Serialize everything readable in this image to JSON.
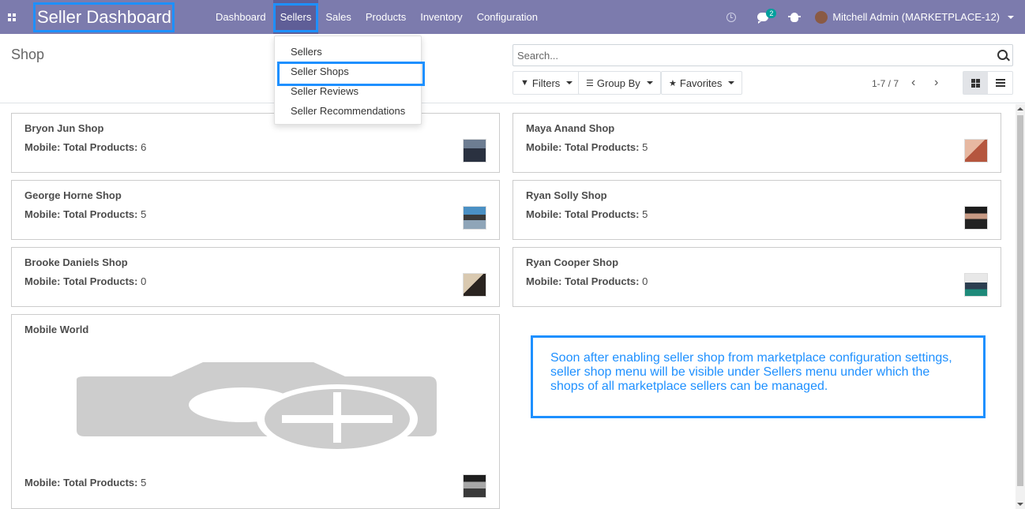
{
  "navbar": {
    "brand": "Seller Dashboard",
    "menu": [
      "Dashboard",
      "Sellers",
      "Sales",
      "Products",
      "Inventory",
      "Configuration"
    ],
    "active_menu": "Sellers",
    "chat_badge": "2",
    "user": "Mitchell Admin (MARKETPLACE-12)"
  },
  "sellers_dropdown": {
    "items": [
      "Sellers",
      "Seller Shops",
      "Seller Reviews",
      "Seller Recommendations"
    ],
    "highlighted": "Seller Shops"
  },
  "control_panel": {
    "breadcrumb": "Shop",
    "search_placeholder": "Search...",
    "filters_label": "Filters",
    "groupby_label": "Group By",
    "favorites_label": "Favorites",
    "pager": "1-7 / 7"
  },
  "shops": [
    {
      "name": "Bryon Jun Shop",
      "label": "Mobile: Total Products:",
      "count": "6"
    },
    {
      "name": "Maya Anand Shop",
      "label": "Mobile: Total Products:",
      "count": "5"
    },
    {
      "name": "George Horne Shop",
      "label": "Mobile: Total Products:",
      "count": "5"
    },
    {
      "name": "Ryan Solly Shop",
      "label": "Mobile: Total Products:",
      "count": "5"
    },
    {
      "name": "Brooke Daniels Shop",
      "label": "Mobile: Total Products:",
      "count": "0"
    },
    {
      "name": "Ryan Cooper Shop",
      "label": "Mobile: Total Products:",
      "count": "0"
    },
    {
      "name": "Mobile World",
      "label": "Mobile: Total Products:",
      "count": "5"
    }
  ],
  "note": "Soon after enabling seller shop from marketplace configuration settings, seller shop menu will be visible under Sellers menu under which the shops of all marketplace sellers can be managed.",
  "colors": {
    "navbar": "#7c7bad",
    "highlight": "#1e90ff",
    "badge": "#00a09d"
  }
}
